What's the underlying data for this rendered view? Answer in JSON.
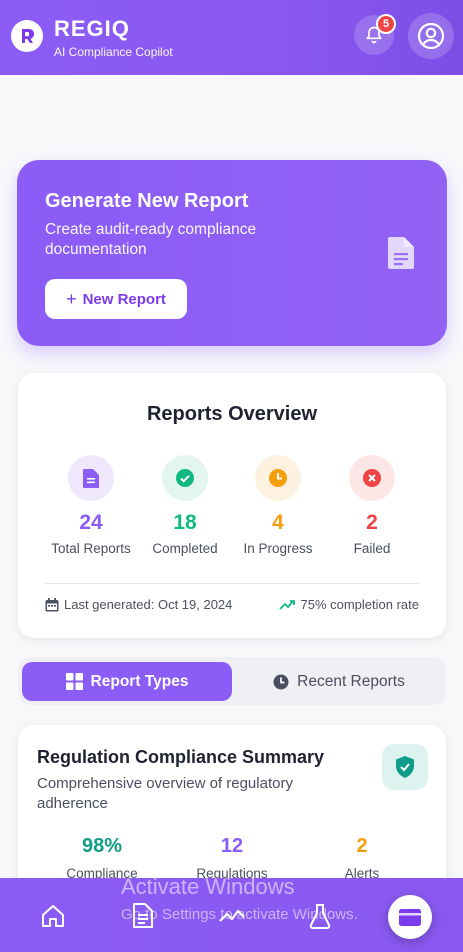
{
  "header": {
    "brand": "REGIQ",
    "tagline": "AI Compliance Copilot",
    "notification_count": "5"
  },
  "generate": {
    "title": "Generate New Report",
    "subtitle": "Create audit-ready compliance documentation",
    "button_label": "New Report"
  },
  "overview": {
    "title": "Reports Overview",
    "stats": [
      {
        "value": "24",
        "label": "Total Reports",
        "color": "#8b5cf6"
      },
      {
        "value": "18",
        "label": "Completed",
        "color": "#10b981"
      },
      {
        "value": "4",
        "label": "In Progress",
        "color": "#f59e0b"
      },
      {
        "value": "2",
        "label": "Failed",
        "color": "#ef4444"
      }
    ],
    "last_generated": "Last generated: Oct 19, 2024",
    "completion": "75% completion rate"
  },
  "tabs": {
    "report_types": "Report Types",
    "recent_reports": "Recent Reports"
  },
  "summary_card": {
    "title": "Regulation Compliance Summary",
    "description": "Comprehensive overview of regulatory adherence",
    "stats": [
      {
        "value": "98%",
        "label": "Compliance",
        "color": "#0f9d8a"
      },
      {
        "value": "12",
        "label": "Regulations",
        "color": "#8b5cf6"
      },
      {
        "value": "2",
        "label": "Alerts",
        "color": "#f59e0b"
      }
    ]
  },
  "watermark": {
    "line1": "Activate Windows",
    "line2": "Go to Settings to activate Windows."
  },
  "colors": {
    "accent": "#8b5cf6",
    "success": "#10b981",
    "warning": "#f59e0b",
    "danger": "#ef4444"
  }
}
